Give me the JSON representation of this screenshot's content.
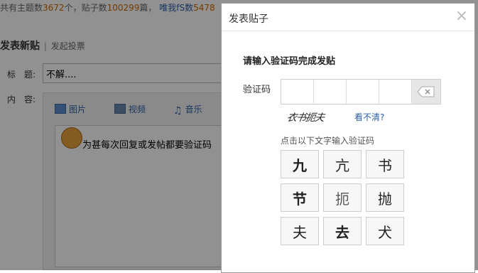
{
  "stats": {
    "prefix": "共有主题数",
    "topics": "3672",
    "topics_unit": "个，贴子数",
    "posts": "100299",
    "posts_unit": "篇，",
    "member_link": "唯我fS数",
    "members": "5478"
  },
  "post": {
    "heading": "发表新贴",
    "separator": "|",
    "vote_link": "发起投票",
    "title_label": "标　题:",
    "title_value": "不解....",
    "content_label": "内　容:",
    "tools": {
      "image": "图片",
      "video": "视频",
      "music": "音乐"
    },
    "body_text": "为甚每次回复或发帖都要验证码"
  },
  "dialog": {
    "title": "发表贴子",
    "close_symbol": "×",
    "prompt": "请输入验证码完成发贴",
    "code_label": "验证码",
    "captcha_text": "衣书扼夫",
    "unclear_link": "看不清?",
    "hint": "点击以下文字输入验证码",
    "chars": [
      "九",
      "亢",
      "书",
      "节",
      "扼",
      "抛",
      "夫",
      "去",
      "犬"
    ]
  }
}
